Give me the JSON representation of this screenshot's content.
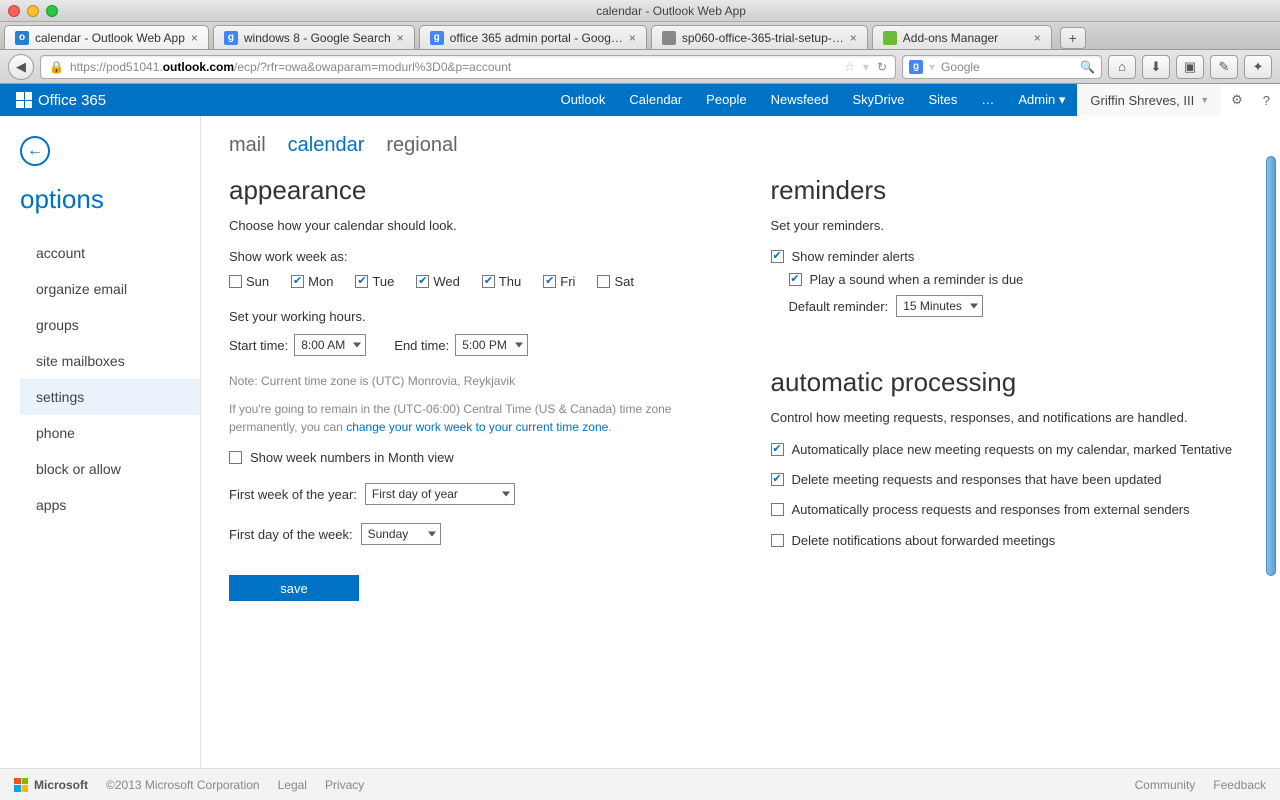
{
  "window": {
    "title": "calendar - Outlook Web App"
  },
  "tabs": [
    {
      "label": "calendar - Outlook Web App",
      "favicon_bg": "#2b7cd3",
      "favicon_text": "o",
      "active": true
    },
    {
      "label": "windows 8 - Google Search",
      "favicon_bg": "#4285f4",
      "favicon_text": "g"
    },
    {
      "label": "office 365 admin portal - Goog…",
      "favicon_bg": "#4285f4",
      "favicon_text": "g"
    },
    {
      "label": "sp060-office-365-trial-setup-…",
      "favicon_bg": "#888",
      "favicon_text": ""
    },
    {
      "label": "Add-ons Manager",
      "favicon_bg": "#6cbb3c",
      "favicon_text": ""
    }
  ],
  "url": {
    "host": "outlook.com",
    "prefix": "https://pod51041.",
    "path": "/ecp/?rfr=owa&owaparam=modurl%3D0&p=account"
  },
  "searchbox": {
    "placeholder": "Google"
  },
  "o365": {
    "brand": "Office 365",
    "nav": [
      "Outlook",
      "Calendar",
      "People",
      "Newsfeed",
      "SkyDrive",
      "Sites",
      "…",
      "Admin ▾"
    ],
    "user": "Griffin Shreves, III"
  },
  "back_label": "←",
  "options_title": "options",
  "sidemenu": [
    "account",
    "organize email",
    "groups",
    "site mailboxes",
    "settings",
    "phone",
    "block or allow",
    "apps"
  ],
  "sidemenu_active": "settings",
  "content_tabs": [
    "mail",
    "calendar",
    "regional"
  ],
  "content_tab_active": "calendar",
  "appearance": {
    "title": "appearance",
    "desc": "Choose how your calendar should look.",
    "show_ww": "Show work week as:",
    "days": [
      {
        "label": "Sun",
        "checked": false
      },
      {
        "label": "Mon",
        "checked": true
      },
      {
        "label": "Tue",
        "checked": true
      },
      {
        "label": "Wed",
        "checked": true
      },
      {
        "label": "Thu",
        "checked": true
      },
      {
        "label": "Fri",
        "checked": true
      },
      {
        "label": "Sat",
        "checked": false
      }
    ],
    "hours_label": "Set your working hours.",
    "start_label": "Start time:",
    "start_value": "8:00 AM",
    "end_label": "End time:",
    "end_value": "5:00 PM",
    "note1": "Note: Current time zone is (UTC) Monrovia, Reykjavik",
    "note2a": "If you're going to remain in the (UTC-06:00) Central Time (US & Canada) time zone permanently, you can ",
    "note2_link": "change your work week to your current time zone",
    "note2b": ".",
    "weeknums": {
      "label": "Show week numbers in Month view",
      "checked": false
    },
    "firstweek_label": "First week of the year:",
    "firstweek_value": "First day of year",
    "firstday_label": "First day of the week:",
    "firstday_value": "Sunday"
  },
  "reminders": {
    "title": "reminders",
    "desc": "Set your reminders.",
    "alerts": {
      "label": "Show reminder alerts",
      "checked": true
    },
    "sound": {
      "label": "Play a sound when a reminder is due",
      "checked": true
    },
    "default_label": "Default reminder:",
    "default_value": "15 Minutes"
  },
  "autoproc": {
    "title": "automatic processing",
    "desc": "Control how meeting requests, responses, and notifications are handled.",
    "opts": [
      {
        "label": "Automatically place new meeting requests on my calendar, marked Tentative",
        "checked": true
      },
      {
        "label": "Delete meeting requests and responses that have been updated",
        "checked": true
      },
      {
        "label": "Automatically process requests and responses from external senders",
        "checked": false
      },
      {
        "label": "Delete notifications about forwarded meetings",
        "checked": false
      }
    ]
  },
  "save_label": "save",
  "footer": {
    "copyright": "©2013 Microsoft Corporation",
    "brand": "Microsoft",
    "legal": "Legal",
    "privacy": "Privacy",
    "community": "Community",
    "feedback": "Feedback"
  }
}
